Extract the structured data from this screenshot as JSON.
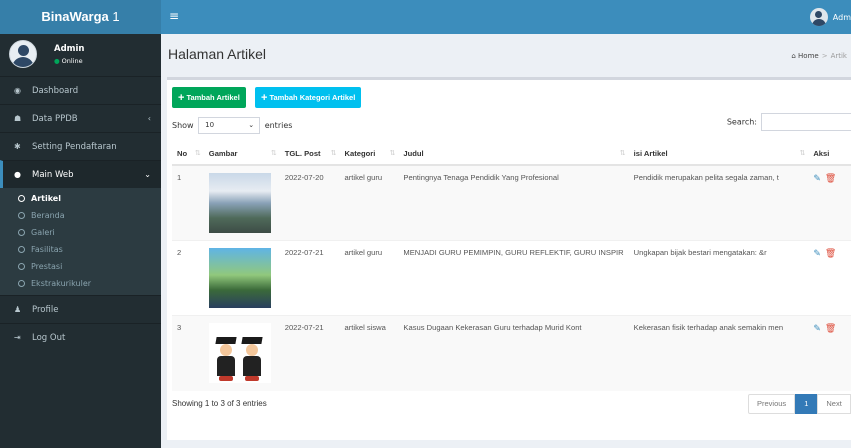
{
  "header": {
    "logo_bold": "BinaWarga",
    "logo_rest": " 1",
    "user_label": "Adm"
  },
  "sidebar": {
    "user_name": "Admin",
    "user_status": "Online",
    "items": [
      {
        "label": "Dashboard",
        "icon": "dashboard-icon"
      },
      {
        "label": "Data PPDB",
        "icon": "users-icon"
      },
      {
        "label": "Setting Pendaftaran",
        "icon": "gear-icon"
      },
      {
        "label": "Main Web",
        "icon": "circle-icon"
      },
      {
        "label": "Profile",
        "icon": "user-icon"
      },
      {
        "label": "Log Out",
        "icon": "sign-out-icon"
      }
    ],
    "submenu": [
      "Artikel",
      "Beranda",
      "Galeri",
      "Fasilitas",
      "Prestasi",
      "Ekstrakurikuler"
    ]
  },
  "page": {
    "title": "Halaman Artikel",
    "breadcrumb_home": "Home",
    "breadcrumb_current": "Artik"
  },
  "toolbar": {
    "add_article": "Tambah Artikel",
    "add_category": "Tambah Kategori Artikel"
  },
  "table_controls": {
    "show_label": "Show",
    "entries_value": "10",
    "entries_label": "entries",
    "search_label": "Search:"
  },
  "table": {
    "headers": [
      "No",
      "Gambar",
      "TGL. Post",
      "Kategori",
      "Judul",
      "isi Artikel",
      "Aksi"
    ],
    "rows": [
      {
        "no": "1",
        "date": "2022-07-20",
        "category": "artikel guru",
        "title": "Pentingnya Tenaga Pendidik Yang Profesional",
        "content": "Pendidik merupakan pelita segala zaman, t"
      },
      {
        "no": "2",
        "date": "2022-07-21",
        "category": "artikel guru",
        "title": "MENJADI GURU PEMIMPIN, GURU REFLEKTIF, GURU INSPIR",
        "content": "Ungkapan bijak bestari mengatakan: &r"
      },
      {
        "no": "3",
        "date": "2022-07-21",
        "category": "artikel siswa",
        "title": "Kasus Dugaan Kekerasan Guru terhadap Murid Kont",
        "content": "Kekerasan fisik terhadap anak semakin men"
      }
    ]
  },
  "footer": {
    "info": "Showing 1 to 3 of 3 entries",
    "previous": "Previous",
    "page": "1",
    "next": "Next"
  },
  "colors": {
    "header": "#3c8dbc",
    "logo": "#367fa9",
    "sidebar": "#222d32",
    "green": "#00a65a",
    "cyan": "#00c0ef",
    "danger": "#dd4b39"
  }
}
